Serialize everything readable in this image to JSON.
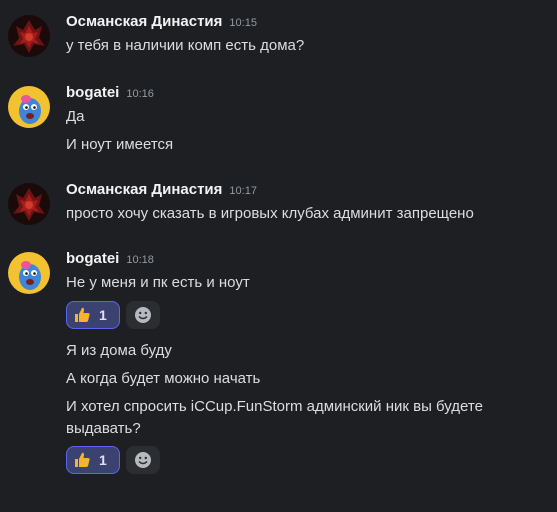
{
  "colors": {
    "background": "#1e1f22",
    "text": "#dbdee1",
    "username": "#f2f3f5",
    "timestamp": "#949ba4",
    "reaction_active_bg": "#3c4270",
    "reaction_active_border": "#5865f2"
  },
  "messages": [
    {
      "author": "Османская Династия",
      "time": "10:15",
      "avatar": "dark-red-avatar-icon",
      "lines": [
        "у тебя в наличии комп есть дома?"
      ]
    },
    {
      "author": "bogatei",
      "time": "10:16",
      "avatar": "blue-cartoon-avatar-icon",
      "lines": [
        "Да",
        "И ноут имеется"
      ]
    },
    {
      "author": "Османская Династия",
      "time": "10:17",
      "avatar": "dark-red-avatar-icon",
      "lines": [
        "просто хочу сказать в игровых клубах админит запрещено"
      ]
    },
    {
      "author": "bogatei",
      "time": "10:18",
      "avatar": "blue-cartoon-avatar-icon",
      "lines": [
        "Не у меня и пк есть и ноут",
        "Я из дома буду",
        "А когда будет можно начать",
        "И хотел спросить iCCup.FunStorm админский ник вы будете выдавать?"
      ],
      "reactions": [
        {
          "emoji": "thumbs-up-icon",
          "count": "1"
        },
        {
          "emoji": "thumbs-up-icon",
          "count": "1"
        }
      ]
    }
  ]
}
